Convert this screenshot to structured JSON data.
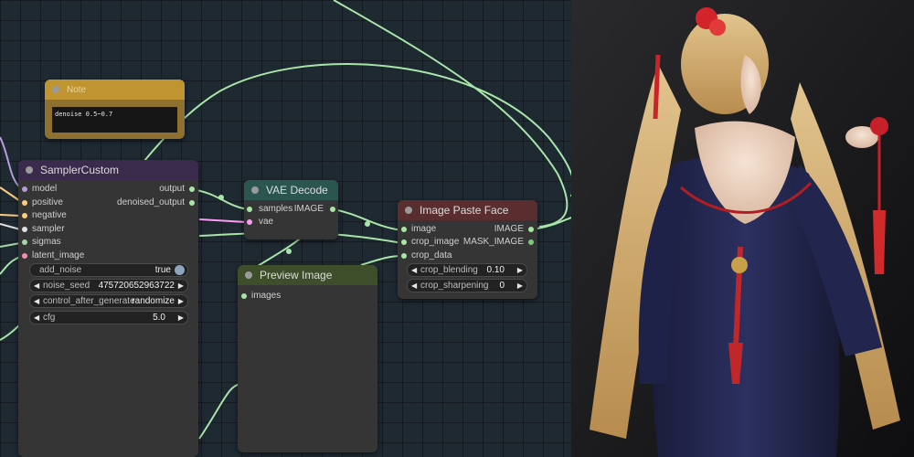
{
  "colors": {
    "canvas_bg": "#1e2932",
    "wire_default": "#a8e6a8",
    "wire_vae": "#ff9cf9",
    "note_header": "#c09430",
    "sampler_header": "#3a2a4b",
    "vae_header": "#2b5650",
    "preview_header": "#3e4e2a",
    "paste_header": "#5a2e2e"
  },
  "note_node": {
    "title": "Note",
    "text": "denoise 0.5~0.7"
  },
  "sampler_node": {
    "title": "SamplerCustom",
    "inputs": [
      {
        "label": "model",
        "color": "#b39ddb"
      },
      {
        "label": "positive",
        "color": "#ffcc80"
      },
      {
        "label": "negative",
        "color": "#ffcc80"
      },
      {
        "label": "sampler",
        "color": "#e0e0e0"
      },
      {
        "label": "sigmas",
        "color": "#a5d6a7"
      },
      {
        "label": "latent_image",
        "color": "#f48fb1"
      }
    ],
    "outputs": [
      {
        "label": "output",
        "color": "#f48fb1"
      },
      {
        "label": "denoised_output",
        "color": "#f48fb1"
      }
    ],
    "widgets": {
      "add_noise": {
        "label": "add_noise",
        "value": "true"
      },
      "noise_seed": {
        "label": "noise_seed",
        "value": "475720652963722"
      },
      "control_after_generate": {
        "label": "control_after_generate",
        "value": "randomize"
      },
      "cfg": {
        "label": "cfg",
        "value": "5.0"
      }
    }
  },
  "vae_decode_node": {
    "title": "VAE Decode",
    "inputs": [
      {
        "label": "samples",
        "color": "#f48fb1"
      },
      {
        "label": "vae",
        "color": "#ff8a80"
      }
    ],
    "output": {
      "label": "IMAGE",
      "color": "#64b5f6"
    }
  },
  "preview_node": {
    "title": "Preview Image",
    "input": {
      "label": "images",
      "color": "#64b5f6"
    }
  },
  "paste_node": {
    "title": "Image Paste Face",
    "inputs": [
      {
        "label": "image",
        "color": "#64b5f6"
      },
      {
        "label": "crop_image",
        "color": "#64b5f6"
      },
      {
        "label": "crop_data",
        "color": "#e0e0e0"
      }
    ],
    "outputs": [
      {
        "label": "IMAGE",
        "color": "#64b5f6"
      },
      {
        "label": "MASK_IMAGE",
        "color": "#81c784"
      }
    ],
    "widgets": {
      "crop_blending": {
        "label": "crop_blending",
        "value": "0.10"
      },
      "crop_sharpening": {
        "label": "crop_sharpening",
        "value": "0"
      }
    }
  },
  "icons": {
    "arrow_left": "◀",
    "arrow_right": "▶"
  }
}
